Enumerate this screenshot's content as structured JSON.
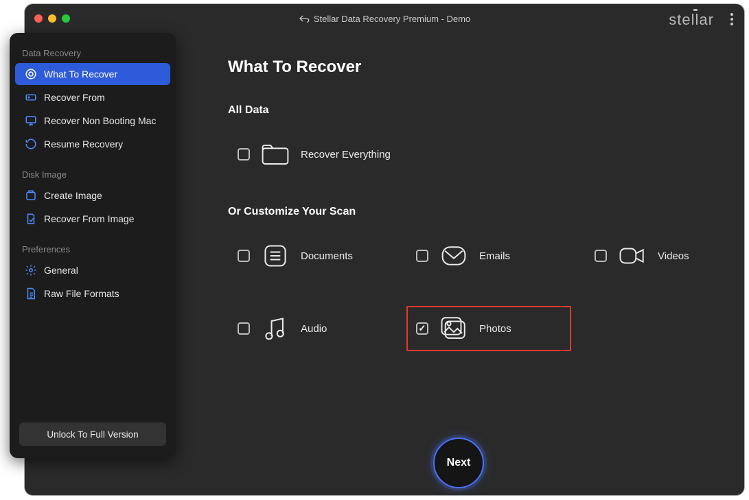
{
  "titlebar": {
    "title": "Stellar Data Recovery Premium - Demo"
  },
  "brand": "stellar",
  "sidebar": {
    "sections": [
      {
        "title": "Data Recovery",
        "items": [
          {
            "label": "What To Recover",
            "active": true
          },
          {
            "label": "Recover From"
          },
          {
            "label": "Recover Non Booting Mac"
          },
          {
            "label": "Resume Recovery"
          }
        ]
      },
      {
        "title": "Disk Image",
        "items": [
          {
            "label": "Create Image"
          },
          {
            "label": "Recover From Image"
          }
        ]
      },
      {
        "title": "Preferences",
        "items": [
          {
            "label": "General"
          },
          {
            "label": "Raw File Formats"
          }
        ]
      }
    ],
    "unlock_label": "Unlock To Full Version"
  },
  "main": {
    "page_title": "What To Recover",
    "all_data_title": "All Data",
    "customize_title": "Or Customize Your Scan",
    "all_data_option": {
      "label": "Recover Everything",
      "checked": false
    },
    "options": [
      {
        "label": "Documents",
        "checked": false
      },
      {
        "label": "Emails",
        "checked": false
      },
      {
        "label": "Videos",
        "checked": false
      },
      {
        "label": "Audio",
        "checked": false
      },
      {
        "label": "Photos",
        "checked": true,
        "highlight": true
      }
    ],
    "next_label": "Next"
  }
}
